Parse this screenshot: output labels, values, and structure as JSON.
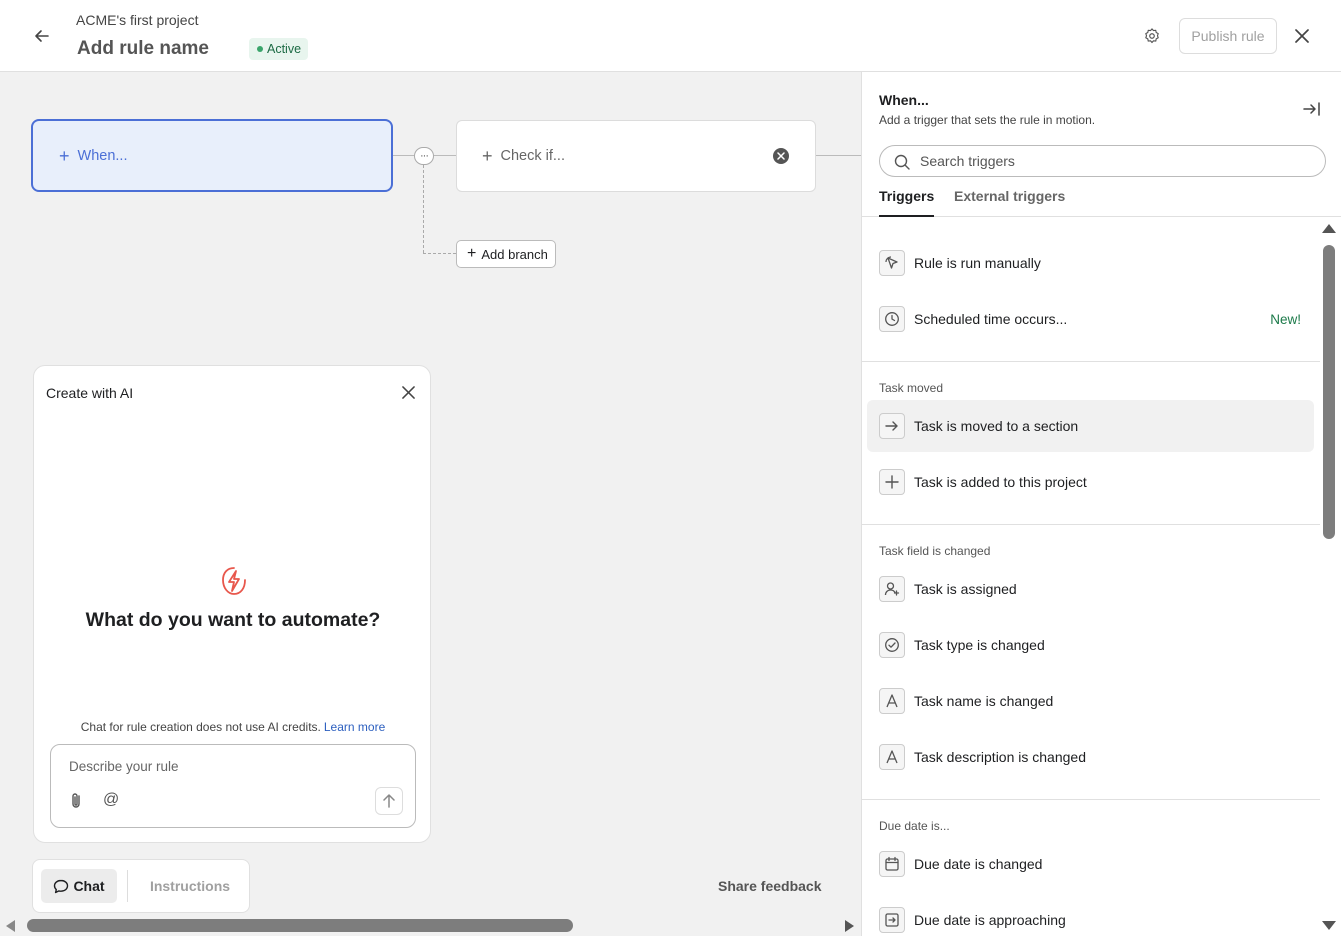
{
  "header": {
    "project_name": "ACME's first project",
    "rule_name": "Add rule name",
    "status": "Active",
    "publish_label": "Publish rule"
  },
  "canvas": {
    "when_label": "When...",
    "check_label": "Check if...",
    "add_branch_label": "Add branch",
    "more_label": "···"
  },
  "ai_panel": {
    "title": "Create with AI",
    "heading": "What do you want to automate?",
    "note": "Chat for rule creation does not use AI credits.",
    "learn_more": "Learn more",
    "input_placeholder": "Describe your rule",
    "mention_symbol": "@"
  },
  "bottom": {
    "tab_chat": "Chat",
    "tab_instructions": "Instructions",
    "share_feedback": "Share feedback"
  },
  "side_panel": {
    "title": "When...",
    "subtitle": "Add a trigger that sets the rule in motion.",
    "search_placeholder": "Search triggers",
    "tabs": [
      "Triggers",
      "External triggers"
    ],
    "sections": [
      {
        "label": "",
        "items": [
          {
            "label": "Rule is run manually",
            "icon": "cursor-click-icon"
          },
          {
            "label": "Scheduled time occurs...",
            "icon": "clock-icon",
            "badge": "New!"
          }
        ]
      },
      {
        "label": "Task moved",
        "items": [
          {
            "label": "Task is moved to a section",
            "icon": "arrow-right-icon"
          },
          {
            "label": "Task is added to this project",
            "icon": "plus-icon"
          }
        ]
      },
      {
        "label": "Task field is changed",
        "items": [
          {
            "label": "Task is assigned",
            "icon": "user-add-icon"
          },
          {
            "label": "Task type is changed",
            "icon": "check-circle-icon"
          },
          {
            "label": "Task name is changed",
            "icon": "letter-a-icon"
          },
          {
            "label": "Task description is changed",
            "icon": "letter-a-icon"
          }
        ]
      },
      {
        "label": "Due date is...",
        "items": [
          {
            "label": "Due date is changed",
            "icon": "calendar-icon"
          },
          {
            "label": "Due date is approaching",
            "icon": "calendar-arrow-icon"
          }
        ]
      }
    ]
  },
  "colors": {
    "accent": "#4b6fd6",
    "status_green": "#1c6b44",
    "new_badge": "#1c7a4a",
    "link": "#2c5fbf"
  }
}
